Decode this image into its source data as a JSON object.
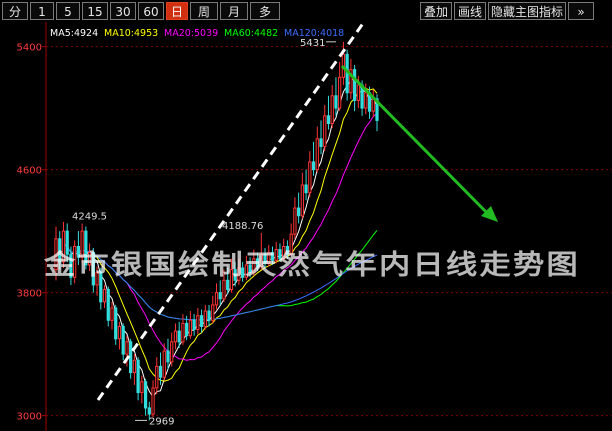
{
  "toolbar": {
    "periods": [
      "分",
      "1",
      "5",
      "15",
      "30",
      "60",
      "日",
      "周",
      "月",
      "多"
    ],
    "active_period": "日",
    "right_buttons": [
      "叠加",
      "画线",
      "隐藏主图指标",
      "»"
    ]
  },
  "ma_legend": [
    {
      "label": "MA5:4924",
      "color": "#ffffff"
    },
    {
      "label": "MA10:4953",
      "color": "#ffff00"
    },
    {
      "label": "MA20:5039",
      "color": "#ff00ff"
    },
    {
      "label": "MA60:4482",
      "color": "#00ff00"
    },
    {
      "label": "MA120:4018",
      "color": "#3d6cff"
    }
  ],
  "watermark": "金市银国绘制天然气年内日线走势图",
  "colors": {
    "up": "#ff3333",
    "down": "#33dddd",
    "grid": "#800000",
    "axis": "#a00000",
    "tick": "#ff3c3c",
    "trend_line": "#ffffff",
    "arrow": "#22bb22"
  },
  "chart_data": {
    "type": "candlestick",
    "title": "",
    "ylim": [
      2900,
      5560
    ],
    "yticks": [
      3000,
      3800,
      4600,
      5400
    ],
    "annotations": [
      {
        "text": "5431",
        "value": 5431
      },
      {
        "text": "4249.5",
        "value": 4249.5
      },
      {
        "text": "4188.76",
        "value": 4188.76
      },
      {
        "text": "2969",
        "value": 2969
      }
    ],
    "candles": [
      [
        3950,
        4150,
        4230,
        3880
      ],
      [
        4150,
        4000,
        4200,
        3950
      ],
      [
        4000,
        4200,
        4260,
        3960
      ],
      [
        4200,
        4050,
        4250,
        4000
      ],
      [
        4050,
        3900,
        4100,
        3850
      ],
      [
        3900,
        4100,
        4140,
        3860
      ],
      [
        4100,
        4030,
        4200,
        3980
      ],
      [
        4030,
        4200,
        4249.5,
        3990
      ],
      [
        4200,
        3980,
        4230,
        3950
      ],
      [
        3980,
        4060,
        4120,
        3940
      ],
      [
        4060,
        3850,
        4090,
        3800
      ],
      [
        3850,
        3930,
        3970,
        3780
      ],
      [
        3930,
        3740,
        3960,
        3690
      ],
      [
        3740,
        3820,
        3850,
        3700
      ],
      [
        3820,
        3620,
        3840,
        3580
      ],
      [
        3620,
        3700,
        3740,
        3560
      ],
      [
        3700,
        3500,
        3720,
        3460
      ],
      [
        3500,
        3580,
        3610,
        3430
      ],
      [
        3580,
        3400,
        3600,
        3360
      ],
      [
        3400,
        3480,
        3520,
        3320
      ],
      [
        3480,
        3280,
        3500,
        3240
      ],
      [
        3280,
        3360,
        3400,
        3200
      ],
      [
        3360,
        3150,
        3380,
        3100
      ],
      [
        3150,
        3220,
        3260,
        3080
      ],
      [
        3220,
        3050,
        3240,
        3000
      ],
      [
        3050,
        3010,
        3090,
        2969
      ],
      [
        3010,
        3180,
        3230,
        2990
      ],
      [
        3180,
        3320,
        3380,
        3140
      ],
      [
        3320,
        3250,
        3410,
        3200
      ],
      [
        3250,
        3420,
        3470,
        3230
      ],
      [
        3420,
        3350,
        3500,
        3300
      ],
      [
        3350,
        3480,
        3540,
        3320
      ],
      [
        3480,
        3550,
        3600,
        3430
      ],
      [
        3550,
        3480,
        3610,
        3440
      ],
      [
        3480,
        3600,
        3660,
        3460
      ],
      [
        3600,
        3520,
        3650,
        3490
      ],
      [
        3520,
        3620,
        3680,
        3500
      ],
      [
        3620,
        3560,
        3660,
        3520
      ],
      [
        3560,
        3650,
        3700,
        3530
      ],
      [
        3650,
        3580,
        3690,
        3540
      ],
      [
        3580,
        3680,
        3720,
        3560
      ],
      [
        3680,
        3620,
        3720,
        3580
      ],
      [
        3620,
        3720,
        3780,
        3600
      ],
      [
        3720,
        3800,
        3860,
        3690
      ],
      [
        3800,
        3760,
        3880,
        3720
      ],
      [
        3760,
        3880,
        3950,
        3740
      ],
      [
        3880,
        3820,
        3960,
        3790
      ],
      [
        3820,
        3950,
        4020,
        3800
      ],
      [
        3950,
        3880,
        4000,
        3840
      ],
      [
        3880,
        3960,
        4020,
        3850
      ],
      [
        3960,
        3900,
        4000,
        3870
      ],
      [
        3900,
        3980,
        4040,
        3880
      ],
      [
        3980,
        3930,
        4030,
        3900
      ],
      [
        3930,
        4020,
        4080,
        3910
      ],
      [
        4020,
        3970,
        4060,
        3940
      ],
      [
        3970,
        4050,
        4188.76,
        3950
      ],
      [
        4050,
        3990,
        4090,
        3960
      ],
      [
        3990,
        4060,
        4110,
        3970
      ],
      [
        4060,
        4010,
        4100,
        3980
      ],
      [
        4010,
        4080,
        4130,
        3990
      ],
      [
        4080,
        4020,
        4120,
        4000
      ],
      [
        4020,
        4100,
        4150,
        4010
      ],
      [
        4100,
        4050,
        4140,
        4020
      ],
      [
        4050,
        4180,
        4250,
        4040
      ],
      [
        4180,
        4350,
        4420,
        4150
      ],
      [
        4350,
        4300,
        4450,
        4250
      ],
      [
        4300,
        4500,
        4580,
        4280
      ],
      [
        4500,
        4450,
        4600,
        4400
      ],
      [
        4450,
        4650,
        4720,
        4420
      ],
      [
        4650,
        4600,
        4780,
        4560
      ],
      [
        4600,
        4800,
        4880,
        4580
      ],
      [
        4800,
        4750,
        4920,
        4700
      ],
      [
        4750,
        4950,
        5020,
        4720
      ],
      [
        4950,
        4900,
        5080,
        4860
      ],
      [
        4900,
        5080,
        5150,
        4870
      ],
      [
        5080,
        5000,
        5200,
        4950
      ],
      [
        5000,
        5200,
        5300,
        4980
      ],
      [
        5200,
        5350,
        5431,
        5150
      ],
      [
        5350,
        5100,
        5380,
        5050
      ],
      [
        5100,
        5250,
        5320,
        5060
      ],
      [
        5250,
        5050,
        5280,
        4980
      ],
      [
        5050,
        5150,
        5210,
        5000
      ],
      [
        5150,
        5000,
        5180,
        4950
      ],
      [
        5000,
        5100,
        5160,
        4960
      ],
      [
        5100,
        4980,
        5140,
        4930
      ],
      [
        4980,
        5060,
        5120,
        4940
      ],
      [
        5060,
        4920,
        5090,
        4850
      ]
    ]
  }
}
